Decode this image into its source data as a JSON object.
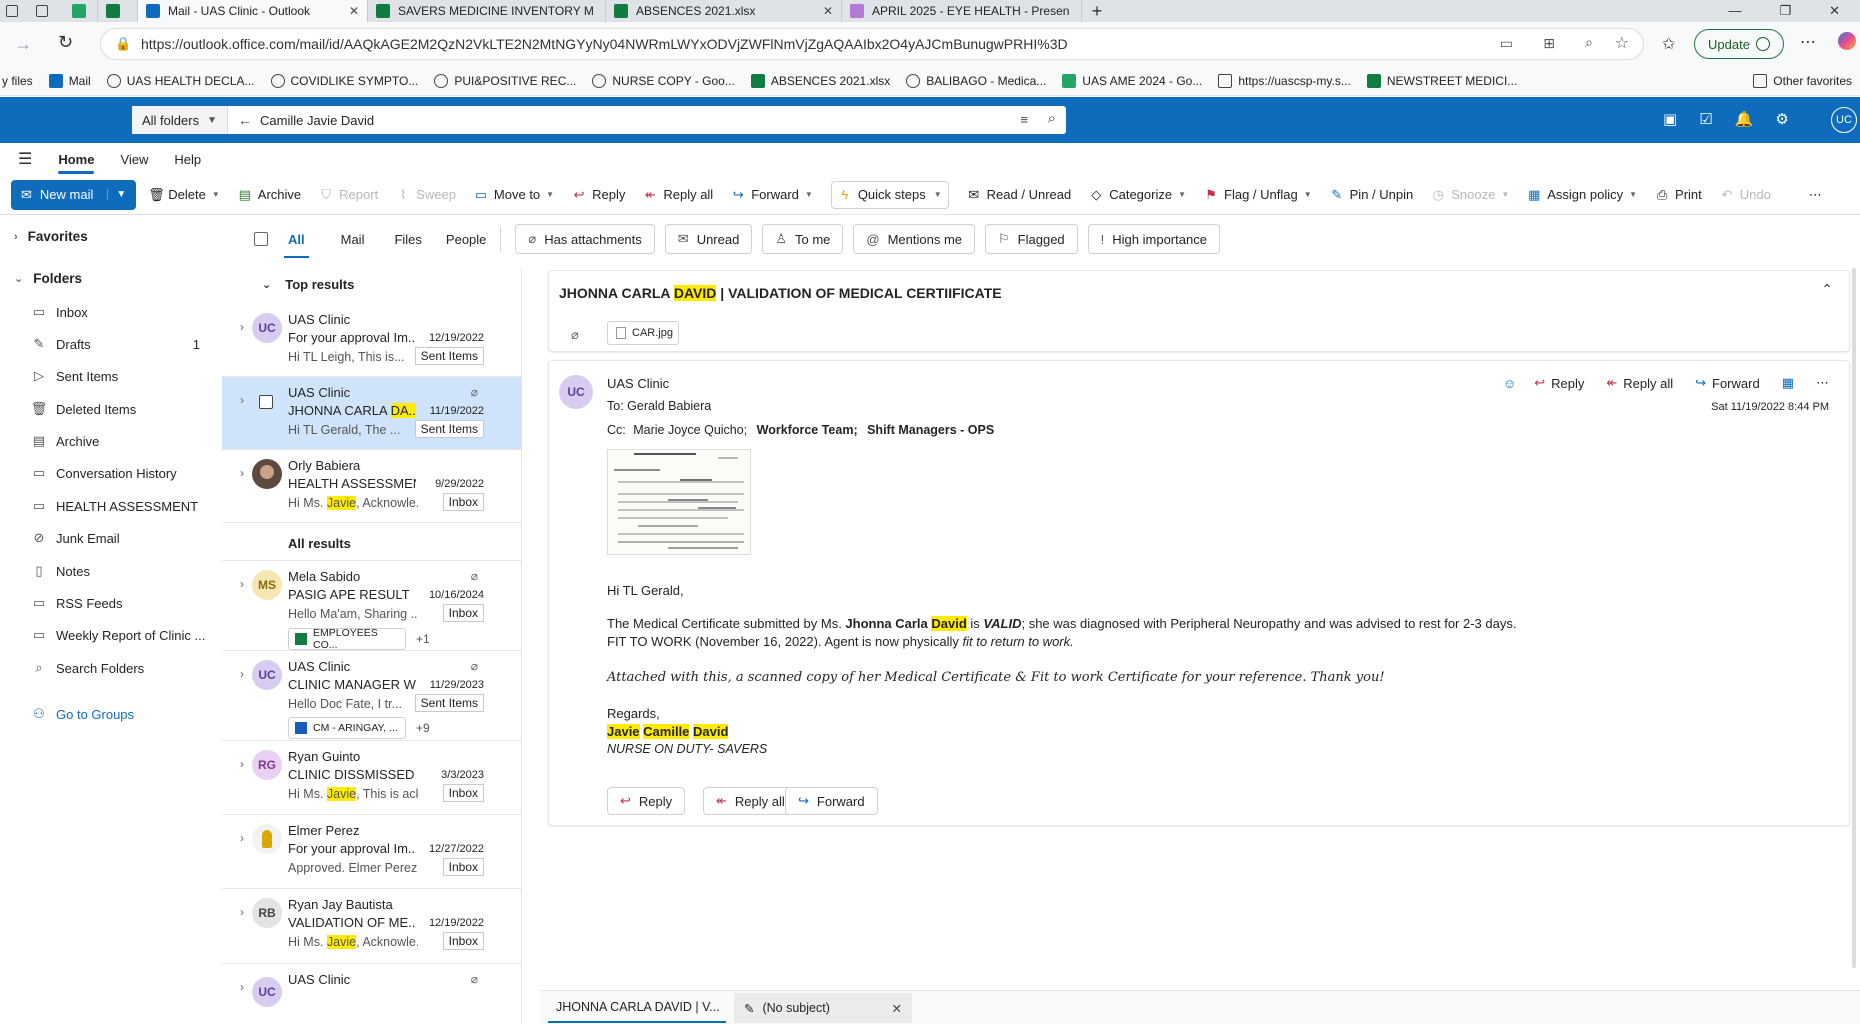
{
  "browser": {
    "tabs": [
      {
        "label": "Mail - UAS Clinic - Outlook",
        "icon": "outlook-icon",
        "color": "#0f6cbd"
      },
      {
        "label": "SAVERS MEDICINE INVENTORY M",
        "icon": "excel-icon",
        "color": "#107c41"
      },
      {
        "label": "ABSENCES 2021.xlsx",
        "icon": "excel-icon",
        "color": "#107c41"
      },
      {
        "label": "APRIL 2025 - EYE HEALTH - Presen",
        "icon": "slides-icon",
        "color": "#b478d8"
      }
    ],
    "url": "https://outlook.office.com/mail/id/AAQkAGE2M2QzN2VkLTE2N2MtNGYyNy04NWRmLWYxODVjZWFlNmVjZgAQAAIbx2O4yAJCmBunugwPRHI%3D",
    "update_label": "Update",
    "profile_initials": "UC",
    "bookmarks": [
      {
        "label": "y files",
        "icon": "none"
      },
      {
        "label": "Mail",
        "icon": "outlook-icon"
      },
      {
        "label": "UAS HEALTH DECLA...",
        "icon": "globe-icon"
      },
      {
        "label": "COVIDLIKE SYMPTO...",
        "icon": "globe-icon"
      },
      {
        "label": "PUI&POSITIVE REC...",
        "icon": "globe-icon"
      },
      {
        "label": "NURSE COPY - Goo...",
        "icon": "globe-icon"
      },
      {
        "label": "ABSENCES 2021.xlsx",
        "icon": "excel-icon"
      },
      {
        "label": "BALIBAGO - Medica...",
        "icon": "globe-icon"
      },
      {
        "label": "UAS AME 2024 - Go...",
        "icon": "sheets-icon"
      },
      {
        "label": "https://uascsp-my.s...",
        "icon": "folder-icon"
      },
      {
        "label": "NEWSTREET MEDICI...",
        "icon": "excel-icon"
      }
    ],
    "other_favorites": "Other favorites"
  },
  "header": {
    "scope": "All folders",
    "search_query": "Camille Javie David",
    "avatar": "UC"
  },
  "ribbon_tabs": [
    "Home",
    "View",
    "Help"
  ],
  "ribbon": {
    "new_mail": "New mail",
    "buttons": [
      {
        "label": "Delete",
        "icon": "trash-icon",
        "enabled": true
      },
      {
        "label": "Archive",
        "icon": "archive-icon",
        "enabled": true
      },
      {
        "label": "Report",
        "icon": "shield-icon",
        "enabled": false
      },
      {
        "label": "Sweep",
        "icon": "broom-icon",
        "enabled": false
      },
      {
        "label": "Move to",
        "icon": "folder-move-icon",
        "enabled": true
      },
      {
        "label": "Reply",
        "icon": "reply-icon",
        "enabled": true
      },
      {
        "label": "Reply all",
        "icon": "reply-all-icon",
        "enabled": true
      },
      {
        "label": "Forward",
        "icon": "forward-icon",
        "enabled": true
      },
      {
        "label": "Quick steps",
        "icon": "lightning-icon",
        "enabled": true
      },
      {
        "label": "Read / Unread",
        "icon": "envelope-icon",
        "enabled": true
      },
      {
        "label": "Categorize",
        "icon": "tag-icon",
        "enabled": true
      },
      {
        "label": "Flag / Unflag",
        "icon": "flag-icon",
        "enabled": true
      },
      {
        "label": "Pin / Unpin",
        "icon": "pin-icon",
        "enabled": true
      },
      {
        "label": "Snooze",
        "icon": "clock-icon",
        "enabled": false
      },
      {
        "label": "Assign policy",
        "icon": "policy-icon",
        "enabled": true
      },
      {
        "label": "Print",
        "icon": "print-icon",
        "enabled": true
      },
      {
        "label": "Undo",
        "icon": "undo-icon",
        "enabled": false
      }
    ]
  },
  "nav": {
    "favorites": "Favorites",
    "folders": "Folders",
    "items": [
      {
        "label": "Inbox",
        "icon": "inbox-icon",
        "count": ""
      },
      {
        "label": "Drafts",
        "icon": "pencil-icon",
        "count": "1"
      },
      {
        "label": "Sent Items",
        "icon": "send-icon",
        "count": ""
      },
      {
        "label": "Deleted Items",
        "icon": "trash-icon",
        "count": ""
      },
      {
        "label": "Archive",
        "icon": "archive-icon",
        "count": ""
      },
      {
        "label": "Conversation History",
        "icon": "folder-icon",
        "count": ""
      },
      {
        "label": "HEALTH ASSESSMENT",
        "icon": "folder-icon",
        "count": ""
      },
      {
        "label": "Junk Email",
        "icon": "junk-icon",
        "count": ""
      },
      {
        "label": "Notes",
        "icon": "note-icon",
        "count": ""
      },
      {
        "label": "RSS Feeds",
        "icon": "rss-icon",
        "count": ""
      },
      {
        "label": "Weekly Report of Clinic ...",
        "icon": "folder-icon",
        "count": ""
      },
      {
        "label": "Search Folders",
        "icon": "search-folder-icon",
        "count": ""
      }
    ],
    "go_to_groups": "Go to Groups"
  },
  "filters": {
    "tabs": [
      "All",
      "Mail",
      "Files",
      "People"
    ],
    "chips": [
      "Has attachments",
      "Unread",
      "To me",
      "Mentions me",
      "Flagged",
      "High importance"
    ]
  },
  "list": {
    "top_results": "Top results",
    "all_results": "All results",
    "items": [
      {
        "sender": "UAS Clinic",
        "subject": "For your approval Im...",
        "date": "12/19/2022",
        "preview": "Hi TL Leigh, This is...",
        "folder": "Sent Items",
        "initials": "UC",
        "avatar_color": "#d8cdf0",
        "avatar_text_color": "#5b3f9c"
      },
      {
        "sender": "UAS Clinic",
        "subject_pre": "JHONNA CARLA ",
        "subject_hl": "DA...",
        "date": "11/19/2022",
        "preview": "Hi TL Gerald, The ...",
        "folder": "Sent Items"
      },
      {
        "sender": "Orly Babiera",
        "subject": "HEALTH ASSESSMEN...",
        "date": "9/29/2022",
        "preview_pre": "Hi Ms. ",
        "preview_hl": "Javie",
        "preview_post": ", Acknowle...",
        "folder": "Inbox"
      },
      {
        "sender": "Mela Sabido",
        "subject": "PASIG APE RESULT",
        "date": "10/16/2024",
        "preview": "Hello Ma'am, Sharing ...",
        "folder": "Inbox",
        "initials": "MS",
        "avatar_color": "#f5e6b3",
        "avatar_text_color": "#8a6d0b",
        "attachment": "EMPLOYEES CO...",
        "more": "+1"
      },
      {
        "sender": "UAS Clinic",
        "subject": "CLINIC MANAGER W...",
        "date": "11/29/2023",
        "preview": "Hello Doc Fate, I tr...",
        "folder": "Sent Items",
        "initials": "UC",
        "avatar_color": "#d8cdf0",
        "avatar_text_color": "#5b3f9c",
        "attachment": "CM - ARINGAY, ...",
        "more": "+9"
      },
      {
        "sender": "Ryan Guinto",
        "subject": "CLINIC DISSMISSED",
        "date": "3/3/2023",
        "preview_pre": "Hi Ms. ",
        "preview_hl": "Javie",
        "preview_post": ", This is ack...",
        "folder": "Inbox",
        "initials": "RG",
        "avatar_color": "#e8d0f2",
        "avatar_text_color": "#7a3a96"
      },
      {
        "sender": "Elmer Perez",
        "subject": "For your approval Im...",
        "date": "12/27/2022",
        "preview": "Approved. Elmer Perez ...",
        "folder": "Inbox"
      },
      {
        "sender": "Ryan Jay Bautista",
        "subject": "VALIDATION OF ME...",
        "date": "12/19/2022",
        "preview_pre": "Hi Ms. ",
        "preview_hl": "Javie",
        "preview_post": ", Acknowle...",
        "folder": "Inbox",
        "initials": "RB",
        "avatar_color": "#e3e3e3",
        "avatar_text_color": "#444"
      },
      {
        "sender": "UAS Clinic",
        "initials": "UC"
      }
    ]
  },
  "reading": {
    "subject_pre": "JHONNA CARLA ",
    "subject_hl": "DAVID",
    "subject_post": " | VALIDATION OF MEDICAL CERTIIFICATE",
    "attachment": "CAR.jpg",
    "from": "UAS Clinic",
    "from_initials": "UC",
    "to": "To:  Gerald Babiera",
    "cc_label": "Cc:",
    "cc": [
      "Marie Joyce Quicho;",
      "Workforce Team;",
      "Shift Managers - OPS"
    ],
    "datetime": "Sat 11/19/2022 8:44 PM",
    "actions": [
      "Reply",
      "Reply all",
      "Forward"
    ],
    "body": {
      "greeting": "Hi TL Gerald,",
      "l1_a": "The Medical Certificate submitted by Ms. ",
      "l1_name": "Jhonna Carla ",
      "l1_hl": "David",
      "l1_b": " is ",
      "l1_valid": "VALID",
      "l1_c": ";  she was diagnosed with Peripheral Neuropathy and was advised to rest for 2-3 days.",
      "l2_a": " FIT TO WORK (November 16, 2022). Agent is now physically ",
      "l2_b": "fit to return to work.",
      "l3": "Attached with this, a scanned copy of her Medical Certificate & Fit to work Certificate for your reference. Thank you!",
      "regards": "Regards,",
      "sig_name": [
        "Javie",
        "Camille",
        "David"
      ],
      "sig_title": "NURSE ON DUTY- SAVERS"
    },
    "buttons": [
      "Reply",
      "Reply all",
      "Forward"
    ]
  },
  "bottom_tabs": [
    "JHONNA CARLA DAVID | V...",
    "(No subject)"
  ]
}
